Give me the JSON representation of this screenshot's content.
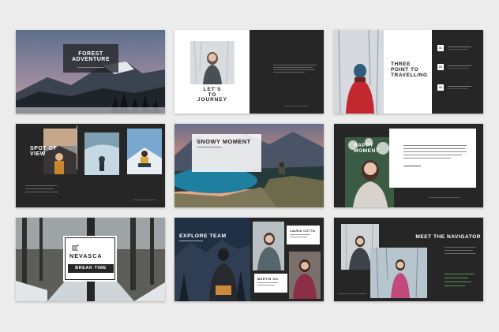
{
  "slides": {
    "s1": {
      "title": "FOREST\nADVENTURE"
    },
    "s2": {
      "title": "LET'S\nTO\nJOURNEY"
    },
    "s3": {
      "title": "THREE\nPOINT TO\nTRAVELLING",
      "items": [
        "01",
        "02",
        "03"
      ]
    },
    "s4": {
      "title": "SPOT OF\nVIEW"
    },
    "s5": {
      "title": "SNOWY MOMENT"
    },
    "s6": {
      "title": "HAPPY\nMOMENT"
    },
    "s7": {
      "brand": "NEVASCA",
      "subtitle": "BREAK TIME"
    },
    "s8": {
      "title": "EXPLORE TEAM",
      "names": [
        "LAURA COTTA",
        "MARTIN GIL"
      ]
    },
    "s9": {
      "title": "MEET THE NAVIGATOR"
    }
  },
  "colors": {
    "dark": "#262626",
    "light": "#ffffff",
    "page": "#ececec"
  }
}
